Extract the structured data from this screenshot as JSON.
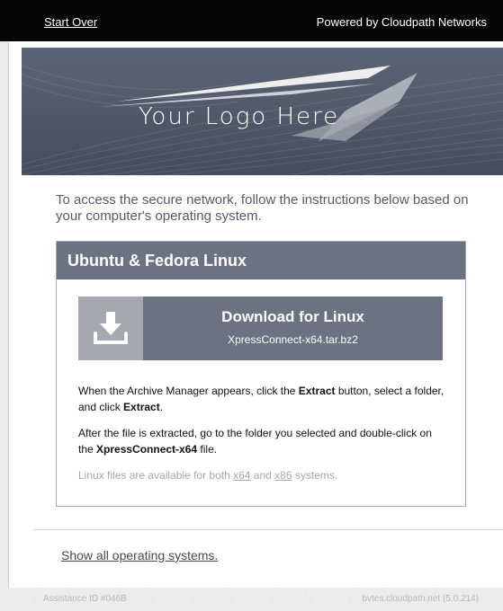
{
  "topbar": {
    "start_over": "Start Over",
    "powered_by": "Powered by Cloudpath Networks"
  },
  "banner": {
    "logo_text": "Your Logo Here"
  },
  "intro": "To access the secure network, follow the instructions below based on your computer's operating system.",
  "panel": {
    "title": "Ubuntu & Fedora Linux",
    "download": {
      "title": "Download for Linux",
      "filename": "XpressConnect-x64.tar.bz2",
      "icon": "download-icon"
    },
    "instruction1": {
      "t1": "When the Archive Manager appears, click the ",
      "b1": "Extract",
      "t2": " button, select a folder, and click ",
      "b2": "Extract",
      "t3": "."
    },
    "instruction2": {
      "t1": "After the file is extracted, go to the folder you selected and double-click on the ",
      "b1": "XpressConnect-x64",
      "t2": " file."
    },
    "note": {
      "t1": "Linux files are available for both ",
      "link1": "x64",
      "t2": " and ",
      "link2": "x86",
      "t3": " systems."
    }
  },
  "show_all": "Show all operating systems.",
  "footer": {
    "assistance_id": "Assistance ID #046B",
    "host_version": "bvtes.cloudpath.net (5.0.214)"
  },
  "colors": {
    "topbar": "#050505",
    "panel_header": "#6b7282",
    "download_button": "#6b7282",
    "icon_box": "#a4a8b0"
  }
}
